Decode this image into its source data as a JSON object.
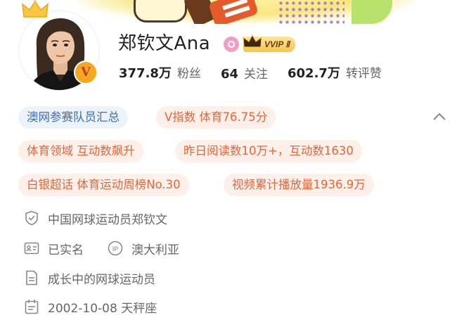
{
  "profile": {
    "name": "郑钦文Ana",
    "vip_badge": "VVIP Ⅱ",
    "verified_mark": "V"
  },
  "stats": [
    {
      "value": "377.8万",
      "label": "粉丝"
    },
    {
      "value": "64",
      "label": "关注"
    },
    {
      "value": "602.7万",
      "label": "转评赞"
    }
  ],
  "tags": {
    "row1": [
      "澳网参赛队员汇总",
      "V指数 体育76.75分"
    ],
    "row2": [
      "体育领域 互动数飙升",
      "昨日阅读数10万+，互动数1630"
    ],
    "row3": [
      "白银超话 体育运动周榜No.30",
      "视频累计播放量1936.9万"
    ]
  },
  "info": {
    "verification": "中国网球运动员郑钦文",
    "real_name": "已实名",
    "ip_icon_text": "IP",
    "ip_location": "澳大利亚",
    "bio": "成长中的网球运动员",
    "birthday": "2002-10-08 天秤座"
  },
  "colors": {
    "tag_blue_bg": "#eef3fa",
    "tag_blue_text": "#3d6db5",
    "tag_orange_bg": "#fdf0ea",
    "tag_orange_text": "#e0683c",
    "gold": "#f5a623"
  },
  "icons": [
    "crown-icon",
    "verified-v-icon",
    "lollipop-icon",
    "vvip-crown-icon",
    "chevron-up-icon",
    "shield-icon",
    "id-card-icon",
    "ip-icon",
    "document-icon",
    "calendar-icon"
  ]
}
